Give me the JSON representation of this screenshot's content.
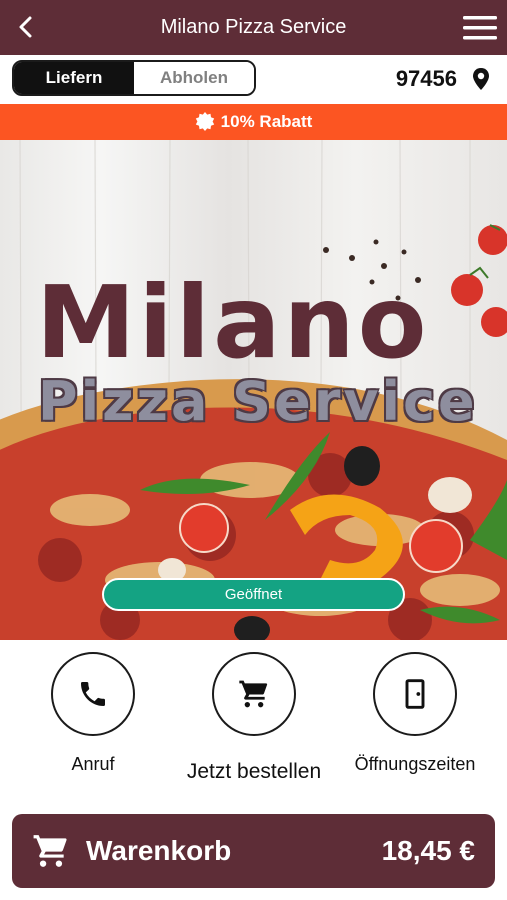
{
  "header": {
    "title": "Milano Pizza Service",
    "back_icon": "chevron-left-icon",
    "menu_icon": "hamburger-menu-icon"
  },
  "delivery_toggle": {
    "options": [
      {
        "label": "Liefern",
        "selected": true
      },
      {
        "label": "Abholen",
        "selected": false
      }
    ]
  },
  "location": {
    "zip": "97456",
    "icon": "map-pin-icon"
  },
  "promo": {
    "text": "10% Rabatt",
    "icon": "badge-icon"
  },
  "hero": {
    "brand_line1": "Milano",
    "brand_line2": "Pizza Service",
    "status_label": "Geöffnet"
  },
  "actions": [
    {
      "label": "Anruf",
      "icon": "phone-icon"
    },
    {
      "label": "Jetzt bestellen",
      "icon": "shopping-cart-icon"
    },
    {
      "label": "Öffnungszeiten",
      "icon": "door-icon"
    }
  ],
  "cart": {
    "label": "Warenkorb",
    "total": "18,45 €",
    "icon": "shopping-cart-icon"
  },
  "colors": {
    "primary": "#5e2d37",
    "promo": "#fc5522",
    "open_status": "#14a383"
  }
}
